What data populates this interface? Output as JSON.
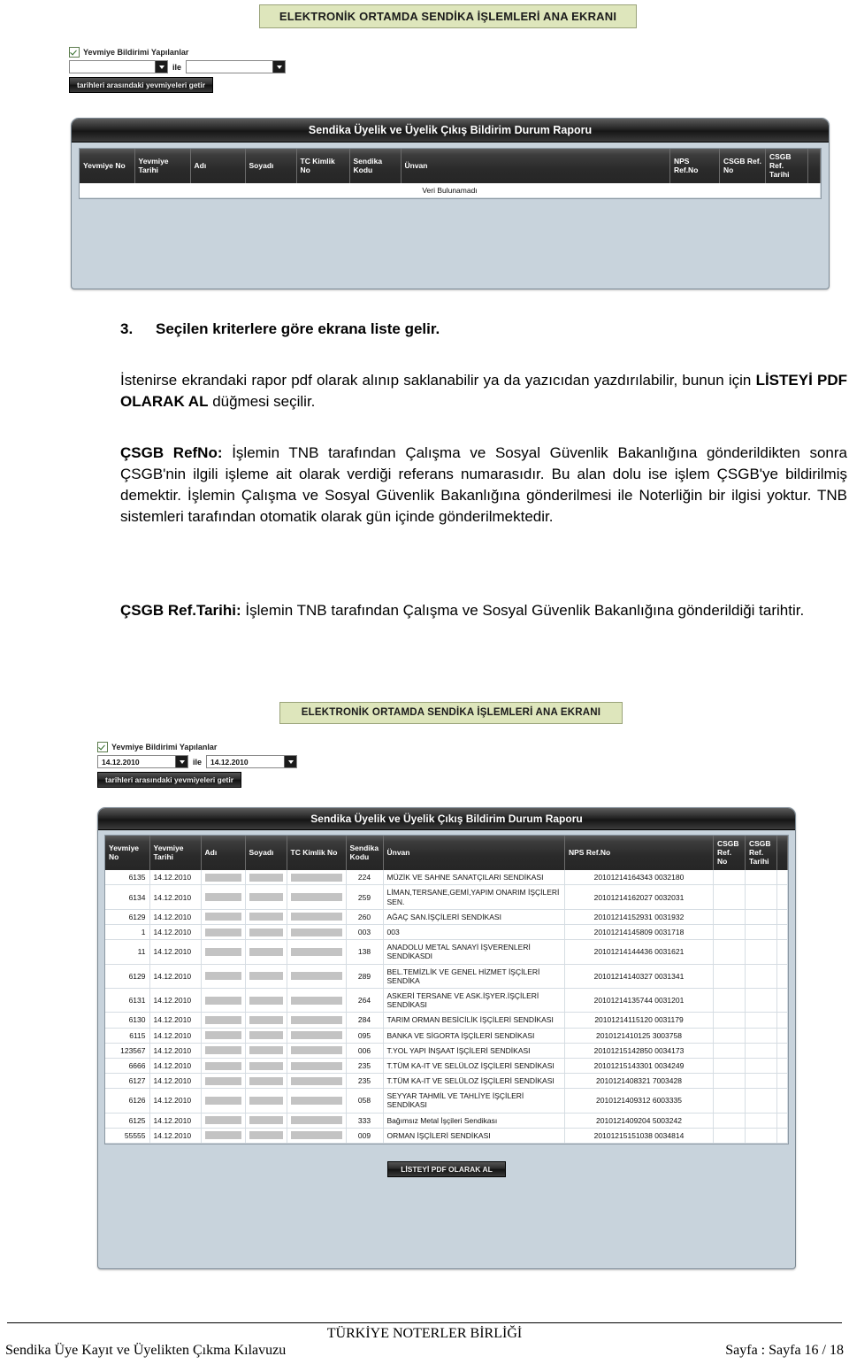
{
  "screen1": {
    "banner": "ELEKTRONİK ORTAMDA SENDİKA İŞLEMLERİ ANA EKRANI",
    "checkbox_label": "Yevmiye Bildirimi Yapılanlar",
    "date_from": "",
    "date_from_placeholder": "",
    "between_label": "ile",
    "date_to": "",
    "date_to_placeholder": "",
    "fetch_button": "tarihleri arasındaki yevmiyeleri getir",
    "report_title": "Sendika Üyelik ve Üyelik Çıkış Bildirim Durum Raporu",
    "columns": [
      "Yevmiye No",
      "Yevmiye Tarihi",
      "Adı",
      "Soyadı",
      "TC Kimlik No",
      "Sendika Kodu",
      "Ünvan",
      "NPS Ref.No",
      "CSGB Ref. No",
      "CSGB Ref. Tarihi",
      ""
    ],
    "empty_message": "Veri Bulunamadı"
  },
  "doc": {
    "step_number": "3.",
    "step_title": "Seçilen kriterlere göre ekrana liste gelir.",
    "para1_a": "İstenirse ekrandaki rapor pdf olarak alınıp saklanabilir ya da yazıcıdan yazdırılabilir, bunun için ",
    "para1_b": "LİSTEYİ PDF OLARAK AL",
    "para1_c": " düğmesi seçilir.",
    "para2_label": "ÇSGB RefNo:",
    "para2_text": " İşlemin TNB tarafından Çalışma ve Sosyal Güvenlik Bakanlığına gönderildikten sonra ÇSGB'nin ilgili işleme ait olarak verdiği referans numarasıdır. Bu alan dolu ise işlem ÇSGB'ye bildirilmiş demektir. İşlemin Çalışma ve Sosyal Güvenlik Bakanlığına gönderilmesi ile Noterliğin bir ilgisi yoktur. TNB sistemleri tarafından otomatik olarak gün içinde gönderilmektedir.",
    "para3_label": "ÇSGB Ref.Tarihi:",
    "para3_text": " İşlemin TNB tarafından Çalışma ve Sosyal Güvenlik Bakanlığına gönderildiği tarihtir."
  },
  "screen2": {
    "banner": "ELEKTRONİK ORTAMDA SENDİKA İŞLEMLERİ ANA EKRANI",
    "checkbox_label": "Yevmiye Bildirimi Yapılanlar",
    "date_from": "14.12.2010",
    "between_label": "ile",
    "date_to": "14.12.2010",
    "fetch_button": "tarihleri arasındaki yevmiyeleri getir",
    "report_title": "Sendika Üyelik ve Üyelik Çıkış Bildirim Durum Raporu",
    "columns": [
      "Yevmiye No",
      "Yevmiye Tarihi",
      "Adı",
      "Soyadı",
      "TC Kimlik No",
      "Sendika Kodu",
      "Ünvan",
      "NPS Ref.No",
      "CSGB Ref. No",
      "CSGB Ref. Tarihi",
      ""
    ],
    "rows": [
      {
        "yevmiye_no": "6135",
        "tarih": "14.12.2010",
        "adi": "",
        "soyadi": "",
        "tc": "",
        "sendika_kodu": "224",
        "unvan": "MÜZİK VE SAHNE SANATÇILARI SENDİKASI",
        "nps": "20101214164343 0032180",
        "csgb_no": "",
        "csgb_tarih": ""
      },
      {
        "yevmiye_no": "6134",
        "tarih": "14.12.2010",
        "adi": "",
        "soyadi": "",
        "tc": "",
        "sendika_kodu": "259",
        "unvan": "LİMAN,TERSANE,GEMİ,YAPIM ONARIM İŞÇİLERİ SEN.",
        "nps": "20101214162027 0032031",
        "csgb_no": "",
        "csgb_tarih": ""
      },
      {
        "yevmiye_no": "6129",
        "tarih": "14.12.2010",
        "adi": "",
        "soyadi": "",
        "tc": "",
        "sendika_kodu": "260",
        "unvan": "AĞAÇ SAN.İŞÇİLERİ SENDİKASI",
        "nps": "20101214152931 0031932",
        "csgb_no": "",
        "csgb_tarih": ""
      },
      {
        "yevmiye_no": "1",
        "tarih": "14.12.2010",
        "adi": "",
        "soyadi": "",
        "tc": "",
        "sendika_kodu": "003",
        "unvan": "003",
        "nps": "20101214145809 0031718",
        "csgb_no": "",
        "csgb_tarih": ""
      },
      {
        "yevmiye_no": "11",
        "tarih": "14.12.2010",
        "adi": "",
        "soyadi": "",
        "tc": "",
        "sendika_kodu": "138",
        "unvan": "ANADOLU METAL SANAYİ İŞVERENLERİ SENDİKASDI",
        "nps": "20101214144436 0031621",
        "csgb_no": "",
        "csgb_tarih": ""
      },
      {
        "yevmiye_no": "6129",
        "tarih": "14.12.2010",
        "adi": "",
        "soyadi": "",
        "tc": "",
        "sendika_kodu": "289",
        "unvan": "BEL.TEMİZLİK VE GENEL HİZMET İŞÇİLERİ SENDİKA",
        "nps": "20101214140327 0031341",
        "csgb_no": "",
        "csgb_tarih": ""
      },
      {
        "yevmiye_no": "6131",
        "tarih": "14.12.2010",
        "adi": "",
        "soyadi": "",
        "tc": "",
        "sendika_kodu": "264",
        "unvan": "ASKERİ TERSANE VE ASK.İŞYER.İŞÇİLERİ SENDİKASI",
        "nps": "20101214135744 0031201",
        "csgb_no": "",
        "csgb_tarih": ""
      },
      {
        "yevmiye_no": "6130",
        "tarih": "14.12.2010",
        "adi": "",
        "soyadi": "",
        "tc": "",
        "sendika_kodu": "284",
        "unvan": "TARIM ORMAN BESİCİLİK İŞÇİLERİ SENDİKASI",
        "nps": "20101214115120 0031179",
        "csgb_no": "",
        "csgb_tarih": ""
      },
      {
        "yevmiye_no": "6115",
        "tarih": "14.12.2010",
        "adi": "",
        "soyadi": "",
        "tc": "",
        "sendika_kodu": "095",
        "unvan": "BANKA VE SİGORTA İŞÇİLERİ SENDİKASI",
        "nps": "2010121410125 3003758",
        "csgb_no": "",
        "csgb_tarih": ""
      },
      {
        "yevmiye_no": "123567",
        "tarih": "14.12.2010",
        "adi": "",
        "soyadi": "",
        "tc": "",
        "sendika_kodu": "006",
        "unvan": "T.YOL YAPI İNŞAAT İŞÇİLERİ SENDİKASI",
        "nps": "20101215142850 0034173",
        "csgb_no": "",
        "csgb_tarih": ""
      },
      {
        "yevmiye_no": "6666",
        "tarih": "14.12.2010",
        "adi": "",
        "soyadi": "",
        "tc": "",
        "sendika_kodu": "235",
        "unvan": "T.TÜM KA-IT VE SELÜLOZ İŞÇİLERİ SENDİKASI",
        "nps": "20101215143301 0034249",
        "csgb_no": "",
        "csgb_tarih": ""
      },
      {
        "yevmiye_no": "6127",
        "tarih": "14.12.2010",
        "adi": "",
        "soyadi": "",
        "tc": "",
        "sendika_kodu": "235",
        "unvan": "T.TÜM KA-IT VE SELÜLOZ İŞÇİLERİ SENDİKASI",
        "nps": "2010121408321 7003428",
        "csgb_no": "",
        "csgb_tarih": ""
      },
      {
        "yevmiye_no": "6126",
        "tarih": "14.12.2010",
        "adi": "",
        "soyadi": "",
        "tc": "",
        "sendika_kodu": "058",
        "unvan": "SEYYAR TAHMİL VE TAHLİYE İŞÇİLERİ SENDİKASI",
        "nps": "2010121409312 6003335",
        "csgb_no": "",
        "csgb_tarih": ""
      },
      {
        "yevmiye_no": "6125",
        "tarih": "14.12.2010",
        "adi": "",
        "soyadi": "",
        "tc": "",
        "sendika_kodu": "333",
        "unvan": "Bağımsız Metal İşçileri Sendikası",
        "nps": "2010121409204 5003242",
        "csgb_no": "",
        "csgb_tarih": ""
      },
      {
        "yevmiye_no": "55555",
        "tarih": "14.12.2010",
        "adi": "",
        "soyadi": "",
        "tc": "",
        "sendika_kodu": "009",
        "unvan": "ORMAN İŞÇİLERİ SENDİKASI",
        "nps": "20101215151038 0034814",
        "csgb_no": "",
        "csgb_tarih": ""
      }
    ],
    "pdf_button": "LİSTEYİ PDF OLARAK AL"
  },
  "footer": {
    "organization": "TÜRKİYE NOTERLER BİRLİĞİ",
    "doc_title": "Sendika Üye Kayıt ve Üyelikten Çıkma Kılavuzu",
    "page_label": "Sayfa : Sayfa 16 / 18"
  },
  "colors": {
    "banner_bg": "#dee6bc",
    "panel_bg": "#c8d3dc",
    "titlebar": "#1a1a1a",
    "redact": "#c3c3c3"
  }
}
